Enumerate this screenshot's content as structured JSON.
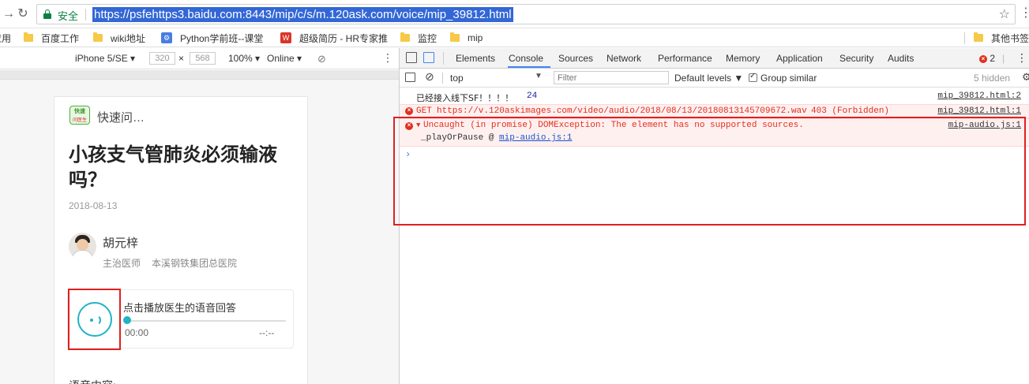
{
  "browser": {
    "secure_label": "安全",
    "url": "https://psfehttps3.baidu.com:8443/mip/c/s/m.120ask.com/voice/mip_39812.html"
  },
  "bookmarks": {
    "apps_label": "应用",
    "items": [
      "百度工作",
      "wiki地址",
      "Python学前班--课堂",
      "超级简历 - HR专家推",
      "监控",
      "mip"
    ],
    "other_label": "其他书签"
  },
  "device_toolbar": {
    "device": "iPhone 5/SE",
    "width": "320",
    "times": "×",
    "height": "568",
    "zoom": "100%",
    "network": "Online"
  },
  "page": {
    "logo_top": "快速",
    "logo_bottom": "问医生",
    "site_name": "快速问…",
    "headline": "小孩支气管肺炎必须输液吗？",
    "date": "2018-08-13",
    "doctor_name": "胡元梓",
    "doctor_title": "主治医师",
    "doctor_hospital": "本溪钢铁集团总医院",
    "audio_title": "点击播放医生的语音回答",
    "audio_progress": 0,
    "time_current": "00:00",
    "time_total": "--:--",
    "section_label": "语音内容:"
  },
  "devtools": {
    "tabs": [
      "Elements",
      "Console",
      "Sources",
      "Network",
      "Performance",
      "Memory",
      "Application",
      "Security",
      "Audits"
    ],
    "active_tab": "Console",
    "error_count": "2",
    "context": "top",
    "filter_placeholder": "Filter",
    "levels": "Default levels",
    "group_similar": "Group similar",
    "hidden": "5 hidden"
  },
  "console": {
    "log1": {
      "text": "已经接入线下SF！！！！",
      "count": "24",
      "source": "mip_39812.html:2"
    },
    "log2": {
      "method": "GET",
      "url": "https://v.120askimages.com/video/audio/2018/08/13/20180813145709672.wav",
      "status": "403 (Forbidden)",
      "source": "mip_39812.html:1"
    },
    "log3": {
      "message": "Uncaught (in promise) DOMException: The element has no supported sources.",
      "source": "mip-audio.js:1",
      "stack_fn": "_playOrPause",
      "stack_at": "@",
      "stack_src": "mip-audio.js:1"
    },
    "prompt": "›"
  },
  "colors": {
    "accent": "#1fb3c6",
    "error": "#e0301e",
    "highlight": "#e02020",
    "url_select": "#3367d6"
  }
}
